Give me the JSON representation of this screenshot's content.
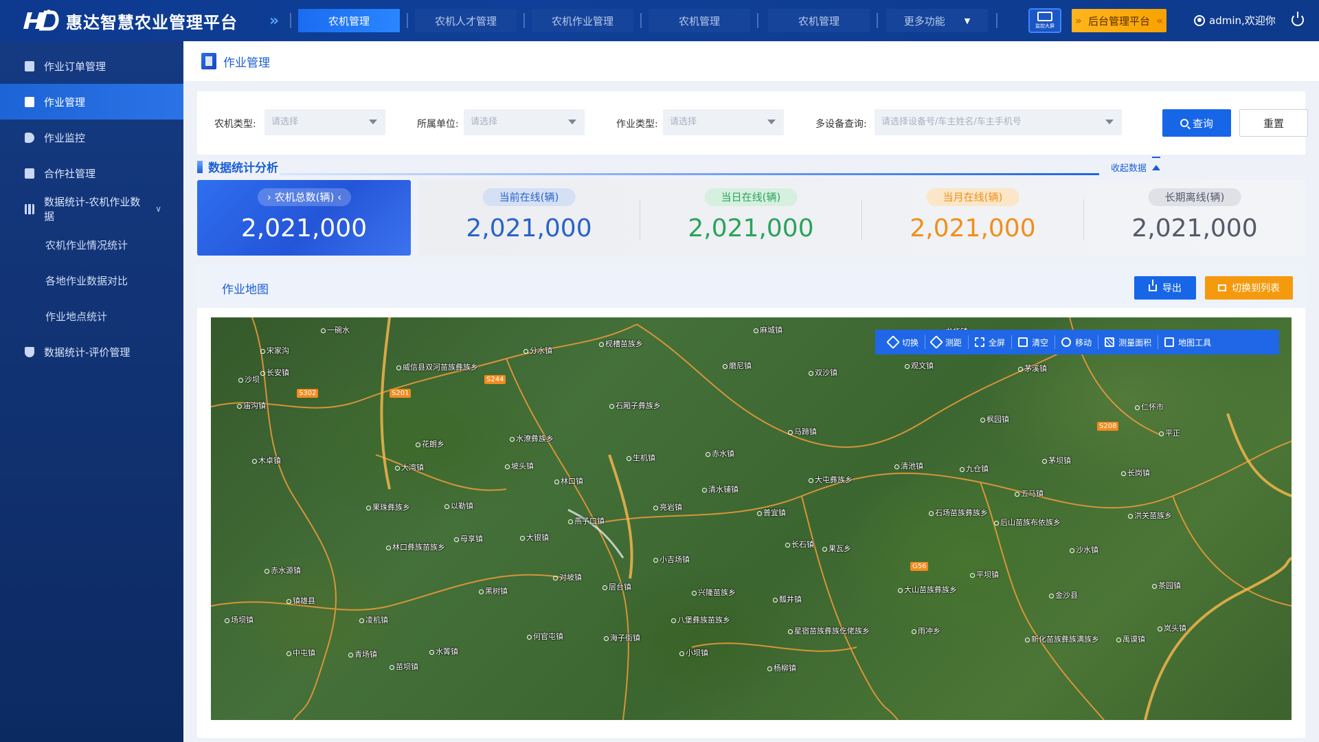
{
  "app": {
    "title": "惠达智慧农业管理平台",
    "logo_mark": "HD"
  },
  "nav": {
    "tabs": [
      "农机管理",
      "农机人才管理",
      "农机作业管理",
      "农机管理",
      "农机管理"
    ],
    "more": "更多功能",
    "monitor_label": "监控大屏",
    "admin_platform": "后台管理平台",
    "user": "admin,欢迎你"
  },
  "sidebar": {
    "items": [
      {
        "label": "作业订单管理",
        "icon": "clipboard-icon"
      },
      {
        "label": "作业管理",
        "icon": "list-icon",
        "active": true
      },
      {
        "label": "作业监控",
        "icon": "camera-icon"
      },
      {
        "label": "合作社管理",
        "icon": "building-icon"
      },
      {
        "label": "数据统计-农机作业数据",
        "icon": "bar-chart-icon"
      },
      {
        "label": "农机作业情况统计",
        "sub": true
      },
      {
        "label": "各地作业数据对比",
        "sub": true
      },
      {
        "label": "作业地点统计",
        "sub": true
      },
      {
        "label": "数据统计-评价管理",
        "icon": "trophy-icon"
      }
    ]
  },
  "page": {
    "title": "作业管理"
  },
  "filters": {
    "machine_type_label": "农机类型:",
    "machine_type_placeholder": "请选择",
    "unit_label": "所属单位:",
    "unit_placeholder": "请选择",
    "work_type_label": "作业类型:",
    "work_type_placeholder": "请选择",
    "multi_label": "多设备查询:",
    "multi_placeholder": "请选择设备号/车主姓名/车主手机号",
    "query": "查询",
    "reset": "重置"
  },
  "stats_section": {
    "title": "数据统计分析",
    "collapse": "收起数据",
    "total": {
      "label": "农机总数(辆)",
      "value": "2,021,000"
    },
    "items": [
      {
        "label": "当前在线(辆)",
        "value": "2,021,000",
        "color": "#2a62c9",
        "pill_bg": "#d5e0f5"
      },
      {
        "label": "当日在线(辆)",
        "value": "2,021,000",
        "color": "#2aa35a",
        "pill_bg": "#d6f0df"
      },
      {
        "label": "当月在线(辆)",
        "value": "2,021,000",
        "color": "#f08f1a",
        "pill_bg": "#fbe6c7"
      },
      {
        "label": "长期离线(辆)",
        "value": "2,021,000",
        "color": "#55596a",
        "pill_bg": "#dfe1e6"
      }
    ]
  },
  "map_section": {
    "title": "作业地图",
    "export": "导出",
    "switch_list": "切换到列表",
    "tools": [
      {
        "label": "切换",
        "icon": "satellite-icon"
      },
      {
        "label": "测距",
        "icon": "ruler-icon"
      },
      {
        "label": "全屏",
        "icon": "fullscreen-icon"
      },
      {
        "label": "清空",
        "icon": "trash-icon"
      },
      {
        "label": "移动",
        "icon": "hand-icon"
      },
      {
        "label": "测量面积",
        "icon": "area-icon"
      },
      {
        "label": "地图工具",
        "icon": "toolbox-icon"
      }
    ],
    "places": [
      "一碗水",
      "宋家沟",
      "沙坝",
      "威信县双河苗族彝族乡",
      "分水镇",
      "枧槽苗族乡",
      "麻城镇",
      "龙华镇",
      "磨尼镇",
      "观文镇",
      "双沙镇",
      "茅溪镇",
      "仁怀市",
      "长安镇",
      "庙沟镇",
      "石厢子彝族乡",
      "花朗乡",
      "水潦彝族乡",
      "马蹄镇",
      "枫园镇",
      "平正",
      "木卓镇",
      "大湾镇",
      "坡头镇",
      "生机镇",
      "赤水镇",
      "林口镇",
      "清池镇",
      "九仓镇",
      "茅坝镇",
      "长岗镇",
      "大屯彝族乡",
      "五马镇",
      "亮岩镇",
      "清水铺镇",
      "果珠彝族乡",
      "以勒镇",
      "普宜镇",
      "燕子口镇",
      "石场苗族彝族乡",
      "后山苗族布依族乡",
      "洪关苗族乡",
      "母享镇",
      "大银镇",
      "长石镇",
      "果瓦乡",
      "小吉场镇",
      "沙水镇",
      "林口彝族苗族乡",
      "赤水源镇",
      "对坡镇",
      "黑树镇",
      "层台镇",
      "兴隆苗族乡",
      "瓢井镇",
      "大山苗族彝族乡",
      "平坝镇",
      "金沙县",
      "茶园镇",
      "镇雄县",
      "凌机镇",
      "八堡彝族苗族乡",
      "岚头镇",
      "场坝镇",
      "何官屯镇",
      "海子街镇",
      "星宿苗族彝族仡佬族乡",
      "雨冲乡",
      "新化苗族彝族满族乡",
      "禹谟镇",
      "中屯镇",
      "青场镇",
      "水箐镇",
      "小坝镇",
      "杨柳镇",
      "苗坝镇"
    ],
    "roads": [
      "S302",
      "S201",
      "S244",
      "S208",
      "G56"
    ]
  },
  "colors": {
    "topbar": "#0f3f98",
    "accent": "#1766e8",
    "orange": "#f59a0e",
    "sidebar": "#12336f"
  }
}
